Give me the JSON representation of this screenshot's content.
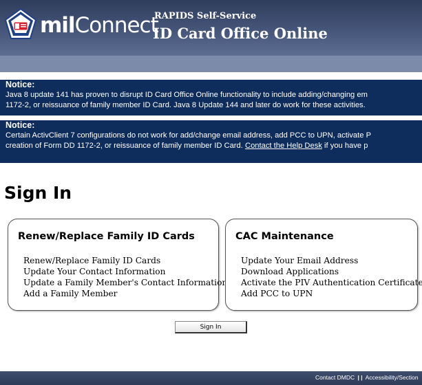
{
  "header": {
    "logo_bold": "mil",
    "logo_rest": "Connect",
    "subtitle": "RAPIDS Self-Service",
    "title": "ID Card Office Online"
  },
  "notices": [
    {
      "title": "Notice:",
      "lines": [
        "Java 8 update 141 has proven to disrupt ID Card Office Online functionality to include adding/changing em",
        "1172-2, or reissuance of family member ID Card. Java 8 Update 144 and later do work for these activities."
      ]
    },
    {
      "title": "Notice:",
      "line1": "Certain ActivClient 7 configurations do not work for add/change email address, add PCC to UPN, activate P",
      "line2_before": "creation of Form DD 1172-2, or reissuance of family member ID Card. ",
      "link": "Contact the Help Desk",
      "line2_after": " if you have p"
    }
  ],
  "signin": {
    "title": "Sign In",
    "button": "Sign In"
  },
  "panels": [
    {
      "heading": "Renew/Replace Family ID Cards",
      "items": [
        "Renew/Replace Family ID Cards",
        "Update Your Contact Information",
        "Update a Family Member's Contact Information",
        "Add a Family Member"
      ]
    },
    {
      "heading": "CAC Maintenance",
      "items": [
        "Update Your Email Address",
        "Download Applications",
        "Activate the PIV Authentication Certificate",
        "Add PCC to UPN"
      ]
    }
  ],
  "footer": {
    "contact": "Contact DMDC",
    "separator": "| |",
    "accessibility": "Accessibility/Section"
  },
  "colors": {
    "header": "#3b4a6b",
    "subbar": "#7d8bab",
    "notice_bg": "#0f2d5c",
    "footer": "#364361",
    "badge_red": "#d8202c",
    "badge_blue": "#1f3f86"
  },
  "icons": {
    "logo": "pentagon-badge-icon"
  }
}
